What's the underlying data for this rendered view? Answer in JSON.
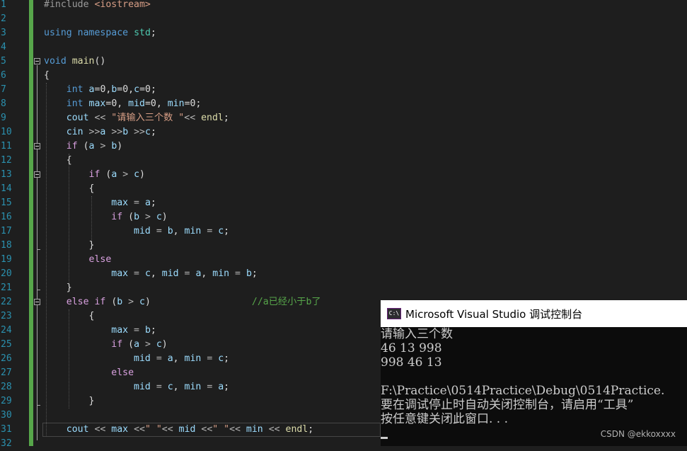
{
  "editor": {
    "line_numbers": [
      "1",
      "2",
      "3",
      "4",
      "5",
      "6",
      "7",
      "8",
      "9",
      "10",
      "11",
      "12",
      "13",
      "14",
      "15",
      "16",
      "17",
      "18",
      "19",
      "20",
      "21",
      "22",
      "23",
      "24",
      "25",
      "26",
      "27",
      "28",
      "29",
      "30",
      "31",
      "32"
    ],
    "code": {
      "l1": {
        "a": "#include ",
        "b": "<iostream>"
      },
      "l3": {
        "a": "using",
        "b": "namespace",
        "c": "std",
        "d": ";"
      },
      "l5": {
        "a": "void",
        "b": "main",
        "c": "()"
      },
      "l6": "{",
      "l7": {
        "a": "int",
        "b": "a",
        "c": "=0,",
        "d": "b",
        "e": "=0,",
        "f": "c",
        "g": "=0;"
      },
      "l8": {
        "a": "int",
        "b": "max",
        "c": "=0, ",
        "d": "mid",
        "e": "=0, ",
        "f": "min",
        "g": "=0;"
      },
      "l9": {
        "a": "cout",
        "b": " << ",
        "c": "\"请输入三个数 \"",
        "d": "<< ",
        "e": "endl",
        "f": ";"
      },
      "l10": {
        "a": "cin",
        "b": " >>",
        "c": "a",
        "d": " >>",
        "e": "b",
        "f": " >>",
        "g": "c",
        "h": ";"
      },
      "l11": {
        "a": "if",
        "b": " (",
        "c": "a",
        "d": " > ",
        "e": "b",
        "f": ")"
      },
      "l12": "{",
      "l13": {
        "a": "if",
        "b": " (",
        "c": "a",
        "d": " > ",
        "e": "c",
        "f": ")"
      },
      "l14": "{",
      "l15": {
        "a": "max",
        "b": " = ",
        "c": "a",
        "d": ";"
      },
      "l16": {
        "a": "if",
        "b": " (",
        "c": "b",
        "d": " > ",
        "e": "c",
        "f": ")"
      },
      "l17": {
        "a": "mid",
        "b": " = ",
        "c": "b",
        "d": ", ",
        "e": "min",
        "f": " = ",
        "g": "c",
        "h": ";"
      },
      "l18": "}",
      "l19": "else",
      "l20": {
        "a": "max",
        "b": " = ",
        "c": "c",
        "d": ", ",
        "e": "mid",
        "f": " = ",
        "g": "a",
        "h": ", ",
        "i": "min",
        "j": " = ",
        "k": "b",
        "l": ";"
      },
      "l21": "}",
      "l22": {
        "a": "else",
        "b": "if",
        "c": " (",
        "d": "b",
        "e": " > ",
        "f": "c",
        "g": ")",
        "h": "//a已经小于b了"
      },
      "l23": "{",
      "l24": {
        "a": "max",
        "b": " = ",
        "c": "b",
        "d": ";"
      },
      "l25": {
        "a": "if",
        "b": " (",
        "c": "a",
        "d": " > ",
        "e": "c",
        "f": ")"
      },
      "l26": {
        "a": "mid",
        "b": " = ",
        "c": "a",
        "d": ", ",
        "e": "min",
        "f": " = ",
        "g": "c",
        "h": ";"
      },
      "l27": "else",
      "l28": {
        "a": "mid",
        "b": " = ",
        "c": "c",
        "d": ", ",
        "e": "min",
        "f": " = ",
        "g": "a",
        "h": ";"
      },
      "l29": "}",
      "l31": {
        "a": "cout",
        "b": " << ",
        "c": "max",
        "d": " <<",
        "e": "\" \"",
        "f": "<< ",
        "g": "mid",
        "h": " <<",
        "i": "\" \"",
        "j": "<< ",
        "k": "min",
        "l": " << ",
        "m": "endl",
        "n": ";"
      }
    }
  },
  "console": {
    "title": "Microsoft Visual Studio 调试控制台",
    "icon_label": "C:\\",
    "lines": [
      "请输入三个数",
      "46 13 998",
      "998 46 13",
      "",
      "F:\\Practice\\0514Practice\\Debug\\0514Practice.",
      "要在调试停止时自动关闭控制台，请启用“工具”",
      "按任意键关闭此窗口. . ."
    ],
    "watermark": "CSDN @ekkoxxxx"
  },
  "colors": {
    "background": "#1e1e1e",
    "keyword": "#569cd6",
    "control": "#d8a0df",
    "string": "#d69d85",
    "variable": "#9cdcfe",
    "comment": "#57a64a",
    "line_number": "#2b91af"
  }
}
